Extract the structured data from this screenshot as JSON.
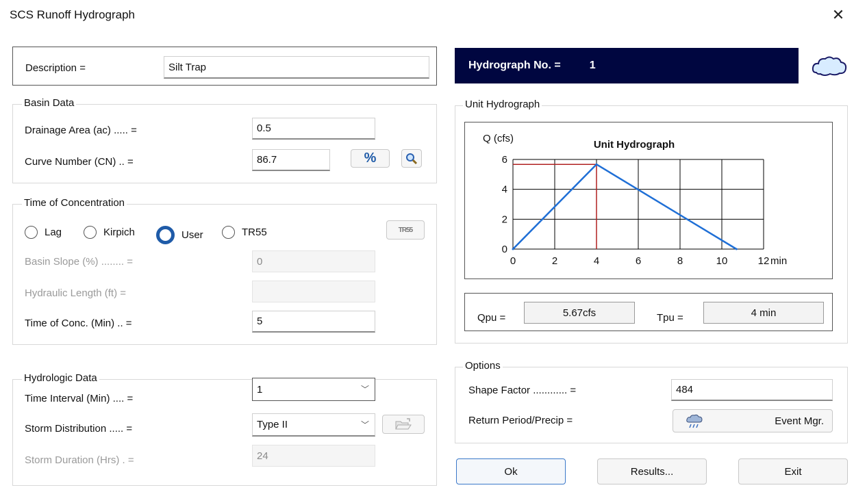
{
  "window": {
    "title": "SCS Runoff Hydrograph",
    "close_glyph": "✕"
  },
  "description": {
    "label": "Description =",
    "value": "Silt Trap"
  },
  "hydrograph_no": {
    "label": "Hydrograph No. =",
    "value": "1"
  },
  "basin": {
    "title": "Basin Data",
    "drainage_area_label": "Drainage Area (ac) ..... =",
    "drainage_area": "0.5",
    "cn_label": "Curve Number (CN) .. =",
    "cn": "86.7",
    "percent_btn": "%"
  },
  "toc": {
    "title": "Time of Concentration",
    "options": [
      "Lag",
      "Kirpich",
      "User",
      "TR55"
    ],
    "selected": "User",
    "tr55_btn": "TR55",
    "basin_slope_label": "Basin Slope (%) ........ =",
    "basin_slope": "0",
    "hydraulic_length_label": "Hydraulic Length (ft) =",
    "hydraulic_length": "",
    "time_conc_label": "Time of Conc. (Min) .. =",
    "time_conc": "5"
  },
  "hydrologic": {
    "title": "Hydrologic Data",
    "interval_label": "Time Interval (Min) .... =",
    "interval": "1",
    "storm_dist_label": "Storm Distribution ..... =",
    "storm_dist": "Type II",
    "storm_duration_label": "Storm Duration (Hrs) . =",
    "storm_duration": "24"
  },
  "unit_hydrograph": {
    "group_title": "Unit Hydrograph",
    "qpu_label": "Qpu =",
    "qpu": "5.67cfs",
    "tpu_label": "Tpu =",
    "tpu": "4 min"
  },
  "options": {
    "title": "Options",
    "shape_label": "Shape Factor ............ =",
    "shape": "484",
    "return_label": "Return Period/Precip  =",
    "event_btn": "Event Mgr."
  },
  "buttons": {
    "ok": "Ok",
    "results": "Results...",
    "exit": "Exit"
  },
  "colors": {
    "header_bg": "#000640",
    "series_line": "#1f6fd6",
    "ref_line": "#b02020",
    "accent_blue": "#1f5ba8"
  },
  "chart_data": {
    "type": "line",
    "title": "Unit Hydrograph",
    "ylabel": "Q (cfs)",
    "xunit": "min",
    "xlim": [
      0,
      12
    ],
    "ylim": [
      0,
      6
    ],
    "xticks": [
      0,
      2,
      4,
      6,
      8,
      10,
      12
    ],
    "yticks": [
      0,
      2,
      4,
      6
    ],
    "grid": true,
    "series": [
      {
        "values": [
          [
            0,
            0
          ],
          [
            4,
            5.67
          ],
          [
            10.7,
            0
          ]
        ]
      }
    ],
    "peak_reference": {
      "x": 4,
      "y": 5.67
    }
  }
}
